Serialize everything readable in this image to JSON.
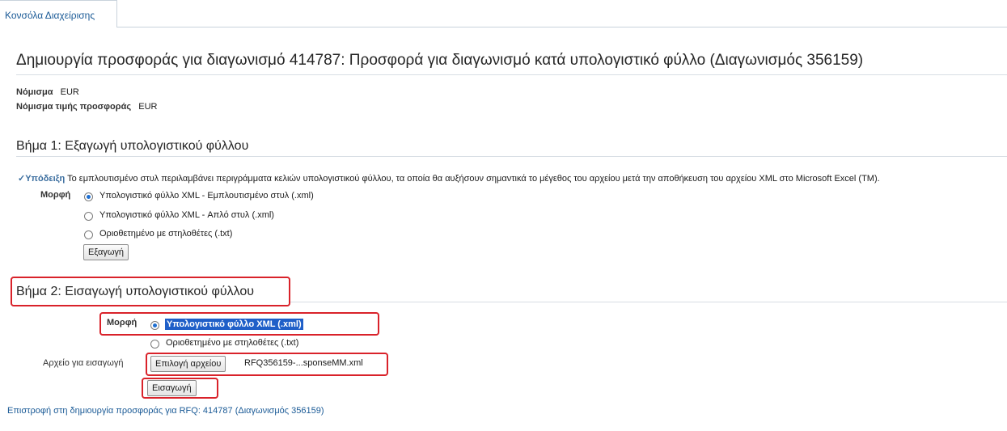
{
  "tab": {
    "label": "Κονσόλα Διαχείρισης"
  },
  "page": {
    "title": "Δημιουργία προσφοράς για διαγωνισμό 414787: Προσφορά για διαγωνισμό κατά υπολογιστικό φύλλο (Διαγωνισμός 356159)"
  },
  "currency": {
    "label": "Νόμισμα",
    "value": "EUR",
    "price_label": "Νόμισμα τιμής προσφοράς",
    "price_value": "EUR"
  },
  "step1": {
    "heading": "Βήμα 1: Εξαγωγή υπολογιστικού φύλλου",
    "tip_label": "Υπόδειξη",
    "tip_text": "Το εμπλουτισμένο στυλ περιλαμβάνει περιγράμματα κελιών υπολογιστικού φύλλου, τα οποία θα αυξήσουν σημαντικά το μέγεθος του αρχείου μετά την αποθήκευση του αρχείου XML στο Microsoft Excel (TM).",
    "format_label": "Μορφή",
    "options": [
      "Υπολογιστικό φύλλο XML - Εμπλουτισμένο στυλ (.xml)",
      "Υπολογιστικό φύλλο XML - Απλό στυλ (.xml)",
      "Οριοθετημένο με στηλοθέτες (.txt)"
    ],
    "selected_index": 0,
    "export_button": "Εξαγωγή"
  },
  "step2": {
    "heading": "Βήμα 2: Εισαγωγή υπολογιστικού φύλλου",
    "format_label": "Μορφή",
    "options": [
      "Υπολογιστικό φύλλο XML (.xml)",
      "Οριοθετημένο με στηλοθέτες (.txt)"
    ],
    "selected_index": 0,
    "file_label": "Αρχείο για εισαγωγή",
    "choose_file_button": "Επιλογή αρχείου",
    "file_name": "RFQ356159-...sponseMM.xml",
    "import_button": "Εισαγωγή"
  },
  "back_link": "Επιστροφή στη δημιουργία προσφοράς για RFQ: 414787 (Διαγωνισμός 356159)",
  "colors": {
    "highlight": "#d9222a",
    "link": "#1a5a96",
    "selection": "#1f5fc8"
  }
}
